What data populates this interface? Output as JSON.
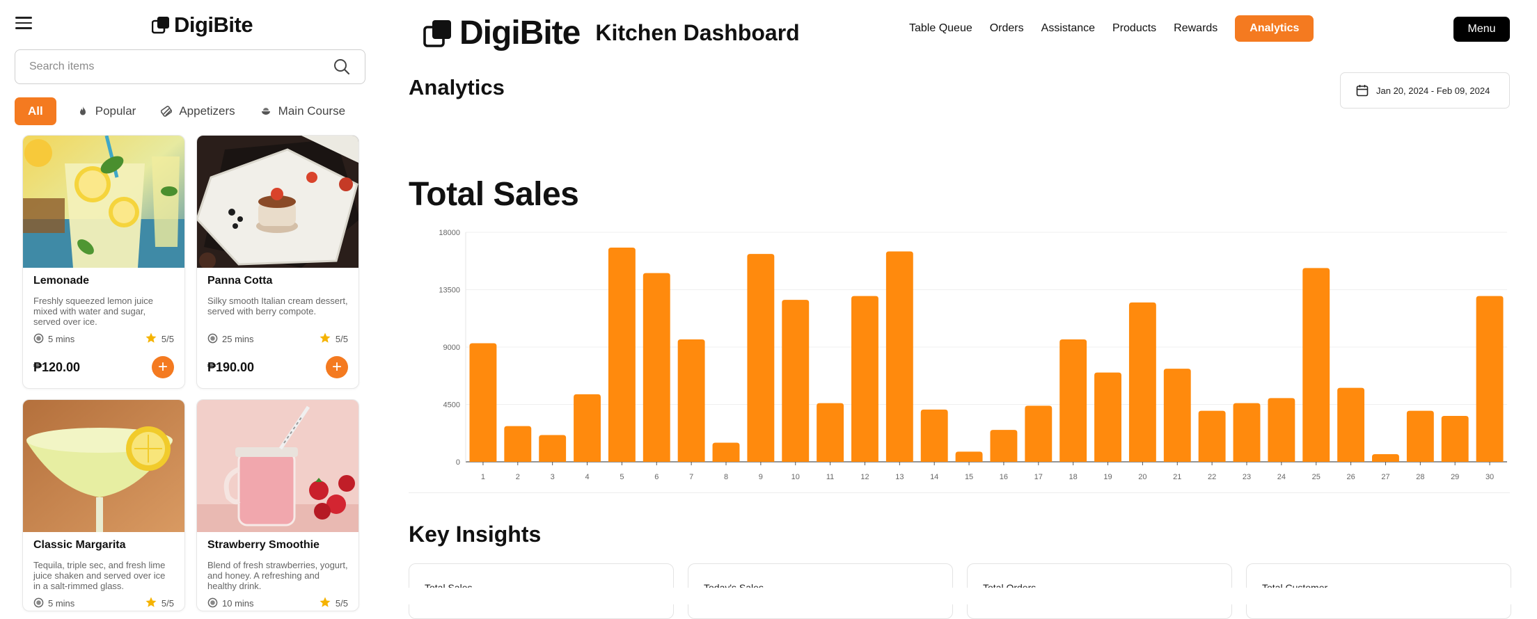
{
  "sidebar": {
    "logo_text": "DigiBite",
    "search_placeholder": "Search items",
    "categories": [
      {
        "label": "All",
        "icon": "none",
        "active": true
      },
      {
        "label": "Popular",
        "icon": "fire-icon"
      },
      {
        "label": "Appetizers",
        "icon": "appetizer-icon"
      },
      {
        "label": "Main Course",
        "icon": "bowl-icon"
      }
    ],
    "products": [
      {
        "name": "Lemonade",
        "desc": "Freshly squeezed lemon juice mixed with water and sugar, served over ice.",
        "time": "5 mins",
        "rating": "5/5",
        "price": "₱120.00"
      },
      {
        "name": "Panna Cotta",
        "desc": "Silky smooth Italian cream dessert, served with berry compote.",
        "time": "25 mins",
        "rating": "5/5",
        "price": "₱190.00"
      },
      {
        "name": "Classic Margarita",
        "desc": "Tequila, triple sec, and fresh lime juice shaken and served over ice in a salt-rimmed glass.",
        "time": "5 mins",
        "rating": "5/5"
      },
      {
        "name": "Strawberry Smoothie",
        "desc": "Blend of fresh strawberries, yogurt, and honey. A refreshing and healthy drink.",
        "time": "10 mins",
        "rating": "5/5"
      }
    ]
  },
  "header": {
    "brand": "DigiBite",
    "subtitle": "Kitchen Dashboard",
    "nav": [
      "Table Queue",
      "Orders",
      "Assistance",
      "Products",
      "Rewards",
      "Analytics"
    ],
    "active_nav": "Analytics",
    "menu_label": "Menu"
  },
  "main": {
    "page_title": "Analytics",
    "date_range": "Jan 20, 2024 - Feb 09, 2024",
    "chart_title": "Total Sales",
    "insights_title": "Key Insights",
    "insight_cards": [
      "Total Sales",
      "Today's Sales",
      "Total Orders",
      "Total Customer"
    ]
  },
  "colors": {
    "accent": "#f47a20",
    "bar": "#ff8a0d",
    "text": "#111111"
  },
  "chart_data": {
    "type": "bar",
    "categories": [
      "1",
      "2",
      "3",
      "4",
      "5",
      "6",
      "7",
      "8",
      "9",
      "10",
      "11",
      "12",
      "13",
      "14",
      "15",
      "16",
      "17",
      "18",
      "19",
      "20",
      "21",
      "22",
      "23",
      "24",
      "25",
      "26",
      "27",
      "28",
      "29",
      "30"
    ],
    "values": [
      9300,
      2800,
      2100,
      5300,
      16800,
      14800,
      9600,
      1500,
      16300,
      12700,
      4600,
      13000,
      16500,
      4100,
      800,
      2500,
      4400,
      9600,
      7000,
      12500,
      7300,
      4000,
      4600,
      5000,
      15200,
      5800,
      600,
      4000,
      3600,
      13000
    ],
    "title": "Total Sales",
    "xlabel": "",
    "ylabel": "",
    "ylim": [
      0,
      18000
    ],
    "yticks": [
      "0",
      "4500",
      "9000",
      "13500",
      "18000"
    ],
    "grid": true,
    "legend": "none"
  }
}
